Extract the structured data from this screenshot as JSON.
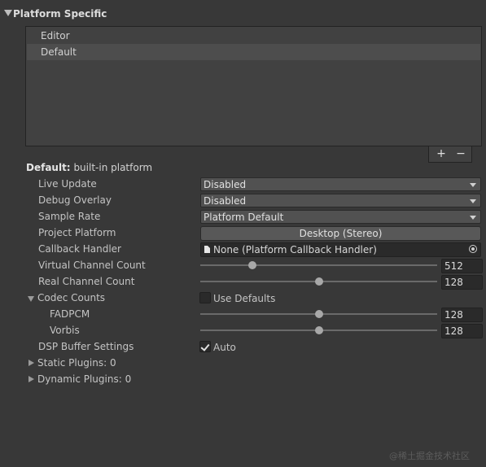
{
  "section": {
    "title": "Platform Specific"
  },
  "platform_list": {
    "items": [
      {
        "label": "Editor",
        "selected": false
      },
      {
        "label": "Default",
        "selected": true
      }
    ],
    "add_label": "+",
    "remove_label": "−"
  },
  "platform_header": {
    "name": "Default:",
    "suffix": "built-in platform"
  },
  "fields": {
    "live_update": {
      "label": "Live Update",
      "value": "Disabled"
    },
    "debug_overlay": {
      "label": "Debug Overlay",
      "value": "Disabled"
    },
    "sample_rate": {
      "label": "Sample Rate",
      "value": "Platform Default"
    },
    "project_platform": {
      "label": "Project Platform",
      "value": "Desktop (Stereo)"
    },
    "callback_handler": {
      "label": "Callback Handler",
      "value": "None (Platform Callback Handler)"
    },
    "virtual_channel_count": {
      "label": "Virtual Channel Count",
      "value": "512",
      "level": 0.22
    },
    "real_channel_count": {
      "label": "Real Channel Count",
      "value": "128",
      "level": 0.5
    },
    "codec_counts": {
      "label": "Codec Counts",
      "use_defaults_label": "Use Defaults",
      "use_defaults": false
    },
    "fadpcm": {
      "label": "FADPCM",
      "value": "128",
      "level": 0.5
    },
    "vorbis": {
      "label": "Vorbis",
      "value": "128",
      "level": 0.5
    },
    "dsp_buffer": {
      "label": "DSP Buffer Settings",
      "auto_label": "Auto",
      "auto": true
    },
    "static_plugins": {
      "label": "Static Plugins: 0"
    },
    "dynamic_plugins": {
      "label": "Dynamic Plugins: 0"
    }
  },
  "watermark": "@稀土掘金技术社区"
}
